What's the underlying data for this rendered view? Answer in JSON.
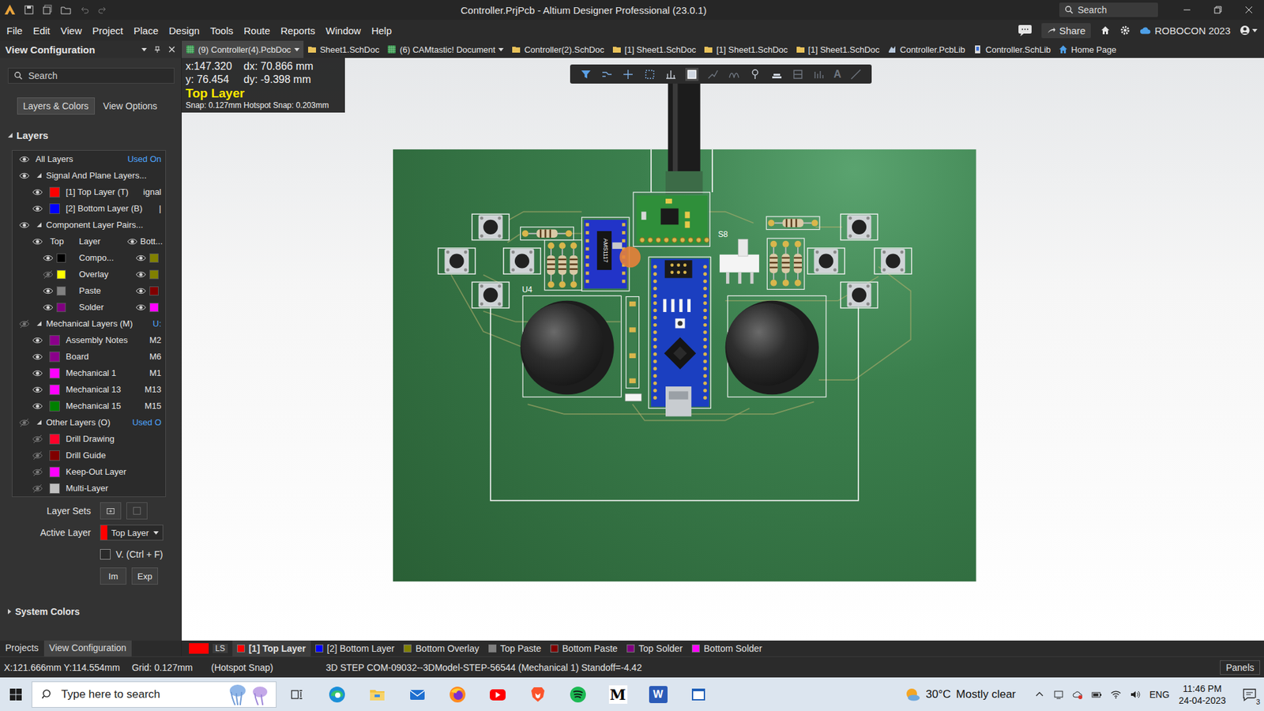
{
  "window": {
    "title": "Controller.PrjPcb - Altium Designer Professional (23.0.1)",
    "search_placeholder": "Search"
  },
  "menu": [
    "File",
    "Edit",
    "View",
    "Project",
    "Place",
    "Design",
    "Tools",
    "Route",
    "Reports",
    "Window",
    "Help"
  ],
  "account": {
    "share": "Share",
    "workspace": "ROBOCON 2023"
  },
  "doc_tabs": [
    {
      "label": "(9) Controller(4).PcbDoc",
      "kind": "pcb",
      "has_menu": true,
      "selected": true
    },
    {
      "label": "Sheet1.SchDoc",
      "kind": "sch",
      "has_menu": false,
      "selected": false
    },
    {
      "label": "(6) CAMtastic! Document",
      "kind": "cam",
      "has_menu": true,
      "selected": false
    },
    {
      "label": "Controller(2).SchDoc",
      "kind": "sch",
      "has_menu": false,
      "selected": false
    },
    {
      "label": "[1] Sheet1.SchDoc",
      "kind": "sch",
      "has_menu": false,
      "selected": false
    },
    {
      "label": "[1] Sheet1.SchDoc",
      "kind": "sch",
      "has_menu": false,
      "selected": false
    },
    {
      "label": "[1] Sheet1.SchDoc",
      "kind": "sch",
      "has_menu": false,
      "selected": false
    },
    {
      "label": "Controller.PcbLib",
      "kind": "pcblib",
      "has_menu": false,
      "selected": false
    },
    {
      "label": "Controller.SchLib",
      "kind": "schlib",
      "has_menu": false,
      "selected": false
    },
    {
      "label": "Home Page",
      "kind": "home",
      "has_menu": false,
      "selected": false
    }
  ],
  "panel": {
    "title": "View Configuration",
    "search_placeholder": "Search",
    "tabs": [
      {
        "label": "Layers & Colors",
        "selected": true
      },
      {
        "label": "View Options",
        "selected": false
      }
    ],
    "section": {
      "label": "Layers",
      "expanded": true
    },
    "rows": [
      {
        "kind": "all",
        "label": "All Layers",
        "extra": "Used On",
        "visible": true
      },
      {
        "kind": "group",
        "label": "Signal And Plane Layers...",
        "extra": "",
        "expanded": true,
        "visible": true
      },
      {
        "kind": "layer",
        "label": "[1] Top Layer (T)",
        "extra": "ignal",
        "color": "#ff0000",
        "visible": true
      },
      {
        "kind": "layer",
        "label": "[2] Bottom Layer (B)",
        "extra": "|",
        "color": "#0000ff",
        "visible": true
      },
      {
        "kind": "group",
        "label": "Component Layer Pairs...",
        "extra": "",
        "expanded": true,
        "visible": true
      },
      {
        "kind": "pair-header",
        "label": "Top",
        "sub": "Layer",
        "right": "Bott...",
        "visible": true,
        "right_visible": true
      },
      {
        "kind": "pair",
        "label": "Compo...",
        "color": "#000000",
        "right_color": "#808000",
        "visible": true,
        "right_visible": true
      },
      {
        "kind": "pair",
        "label": "Overlay",
        "color": "#ffff00",
        "right_color": "#808000",
        "visible": false,
        "right_visible": true
      },
      {
        "kind": "pair",
        "label": "Paste",
        "color": "#808080",
        "right_color": "#800000",
        "visible": true,
        "right_visible": true
      },
      {
        "kind": "pair",
        "label": "Solder",
        "color": "#800080",
        "right_color": "#ff00ff",
        "visible": true,
        "right_visible": true
      },
      {
        "kind": "group",
        "label": "Mechanical Layers (M)",
        "extra": "U:",
        "expanded": true,
        "visible": false
      },
      {
        "kind": "layer",
        "label": "Assembly Notes",
        "extra": "M2",
        "color": "#8b008b",
        "visible": true
      },
      {
        "kind": "layer",
        "label": "Board",
        "extra": "M6",
        "color": "#8b008b",
        "visible": true
      },
      {
        "kind": "layer",
        "label": "Mechanical 1",
        "extra": "M1",
        "color": "#ff00ff",
        "visible": true
      },
      {
        "kind": "layer",
        "label": "Mechanical 13",
        "extra": "M13",
        "color": "#ff00ff",
        "visible": true
      },
      {
        "kind": "layer",
        "label": "Mechanical 15",
        "extra": "M15",
        "color": "#008000",
        "visible": true
      },
      {
        "kind": "group",
        "label": "Other Layers (O)",
        "extra": "Used O",
        "expanded": true,
        "visible": false
      },
      {
        "kind": "layer",
        "label": "Drill Drawing",
        "extra": "",
        "color": "#ff002a",
        "visible": false
      },
      {
        "kind": "layer",
        "label": "Drill Guide",
        "extra": "",
        "color": "#800000",
        "visible": false
      },
      {
        "kind": "layer",
        "label": "Keep-Out Layer",
        "extra": "",
        "color": "#ff00ff",
        "visible": false
      },
      {
        "kind": "layer",
        "label": "Multi-Layer",
        "extra": "",
        "color": "#c0c0c0",
        "visible": false
      }
    ],
    "layer_sets_label": "Layer Sets",
    "active_layer": {
      "label": "Active Layer",
      "value": "Top Layer",
      "color": "#ff0000"
    },
    "checkbox": {
      "label": "V. (Ctrl + F)",
      "checked": false
    },
    "buttons": [
      "Im",
      "Exp"
    ],
    "system_colors": {
      "label": "System Colors",
      "expanded": false
    },
    "bottom_tabs": [
      {
        "label": "Projects",
        "selected": false
      },
      {
        "label": "View Configuration",
        "selected": true
      }
    ]
  },
  "hud": {
    "x": "x:147.320",
    "dx": "dx: 70.866 mm",
    "y": "y: 76.454",
    "dy": "dy: -9.398 mm",
    "layer": "Top Layer",
    "snap": "Snap: 0.127mm Hotspot Snap: 0.203mm"
  },
  "toolbar": {
    "text_tool": "A"
  },
  "board": {
    "u4_label": "U4",
    "s8_label": "S8",
    "chip_text": "AMS1117"
  },
  "layer_tabs": [
    {
      "label": "LS",
      "kind": "set",
      "color": "#ff0000",
      "selected": false
    },
    {
      "label": "[1] Top Layer",
      "kind": "layer",
      "color": "#ff0000",
      "selected": true
    },
    {
      "label": "[2] Bottom Layer",
      "kind": "layer",
      "color": "#0000ff",
      "selected": false
    },
    {
      "label": "Bottom Overlay",
      "kind": "layer",
      "color": "#808000",
      "selected": false
    },
    {
      "label": "Top Paste",
      "kind": "layer",
      "color": "#808080",
      "selected": false
    },
    {
      "label": "Bottom Paste",
      "kind": "layer",
      "color": "#800000",
      "selected": false
    },
    {
      "label": "Top Solder",
      "kind": "layer",
      "color": "#800080",
      "selected": false
    },
    {
      "label": "Bottom Solder",
      "kind": "layer",
      "color": "#ff00ff",
      "selected": false
    }
  ],
  "status_bar": {
    "position": "X:121.666mm Y:114.554mm",
    "grid": "Grid: 0.127mm",
    "snap": "(Hotspot Snap)",
    "info": "3D STEP COM-09032--3DModel-STEP-56544 (Mechanical 1) Standoff=-4.42",
    "panels": "Panels"
  },
  "taskbar": {
    "search_placeholder": "Type here to search",
    "m_app": "M",
    "word_app": "W",
    "weather": {
      "temp": "30°C",
      "text": "Mostly clear"
    },
    "language": "ENG",
    "time": "11:46 PM",
    "date": "24-04-2023",
    "notifications": "3"
  }
}
